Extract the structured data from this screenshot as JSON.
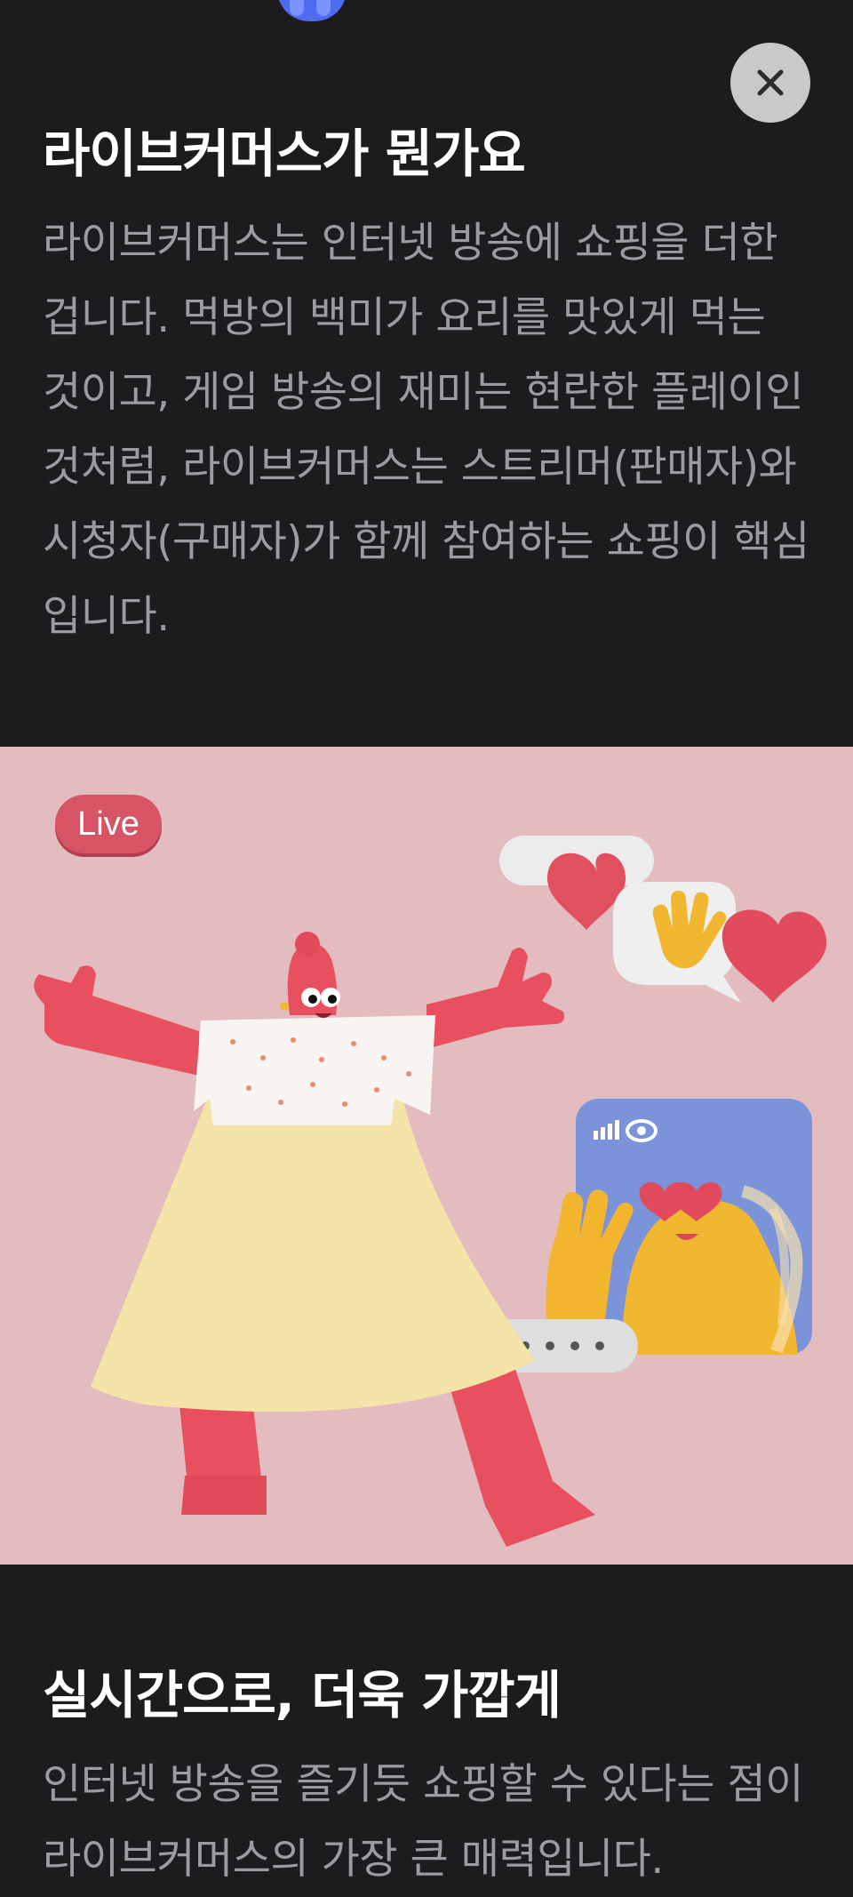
{
  "header": {
    "close_icon": "close-icon"
  },
  "sections": [
    {
      "title": "라이브커머스가 뭔가요",
      "body": "라이브커머스는 인터넷 방송에 쇼핑을 더한 겁니다. 먹방의 백미가 요리를 맛있게 먹는 것이고, 게임 방송의 재미는 현란한 플레이인 것처럼, 라이브커머스는 스트리머(판매자)와 시청자(구매자)가 함께 참여하는 쇼핑이 핵심입니다."
    },
    {
      "title": "실시간으로, 더욱 가깝게",
      "body": "인터넷 방송을 즐기듯 쇼핑할 수 있다는 점이 라이브커머스의 가장 큰 매력입니다."
    }
  ],
  "illustration": {
    "badge": "Live",
    "background": "#e3bcbf",
    "character_color": "#e8505f",
    "dress_color": "#f5e4a8",
    "viewer_color": "#f2b731",
    "screen_color": "#7b93d8"
  }
}
